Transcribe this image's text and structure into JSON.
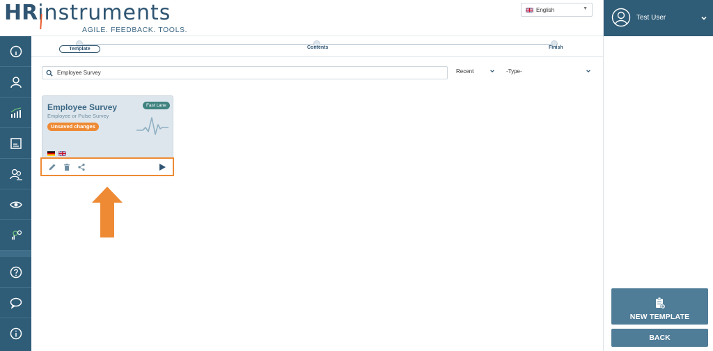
{
  "header": {
    "logo_main": "instruments",
    "logo_prefix": "HR",
    "logo_tagline": "AGILE. FEEDBACK. TOOLS.",
    "language": "English"
  },
  "user": {
    "name": "Test User"
  },
  "stepper": {
    "steps": [
      {
        "label": "Template",
        "active": true
      },
      {
        "label": "Contents",
        "active": false
      },
      {
        "label": "Finish",
        "active": false
      }
    ]
  },
  "search": {
    "value": "Employee Survey",
    "sort": "Recent",
    "type": "-Type-"
  },
  "card": {
    "title": "Employee Survey",
    "subtitle": "Employee or Pulse Survey",
    "badge_unsaved": "Unsaved changes",
    "badge_fastlane": "Fast Lane",
    "flags": [
      "german-flag",
      "uk-flag"
    ]
  },
  "actions": {
    "new_template": "NEW TEMPLATE",
    "back": "BACK"
  },
  "colors": {
    "brand": "#2f5c77",
    "accent": "#ee8a34",
    "teal": "#3f8380",
    "card_bg": "#dde6ec",
    "button": "#4f7c97"
  },
  "sidebar": {
    "items": [
      {
        "icon": "dashboard-gauge-icon"
      },
      {
        "icon": "user-icon"
      },
      {
        "icon": "analytics-chart-icon"
      },
      {
        "icon": "document-list-icon"
      },
      {
        "icon": "team-users-icon"
      },
      {
        "icon": "eye-icon"
      },
      {
        "icon": "settings-chart-icon"
      },
      {
        "icon": "help-icon"
      },
      {
        "icon": "chat-bubble-icon"
      },
      {
        "icon": "info-icon"
      }
    ]
  }
}
